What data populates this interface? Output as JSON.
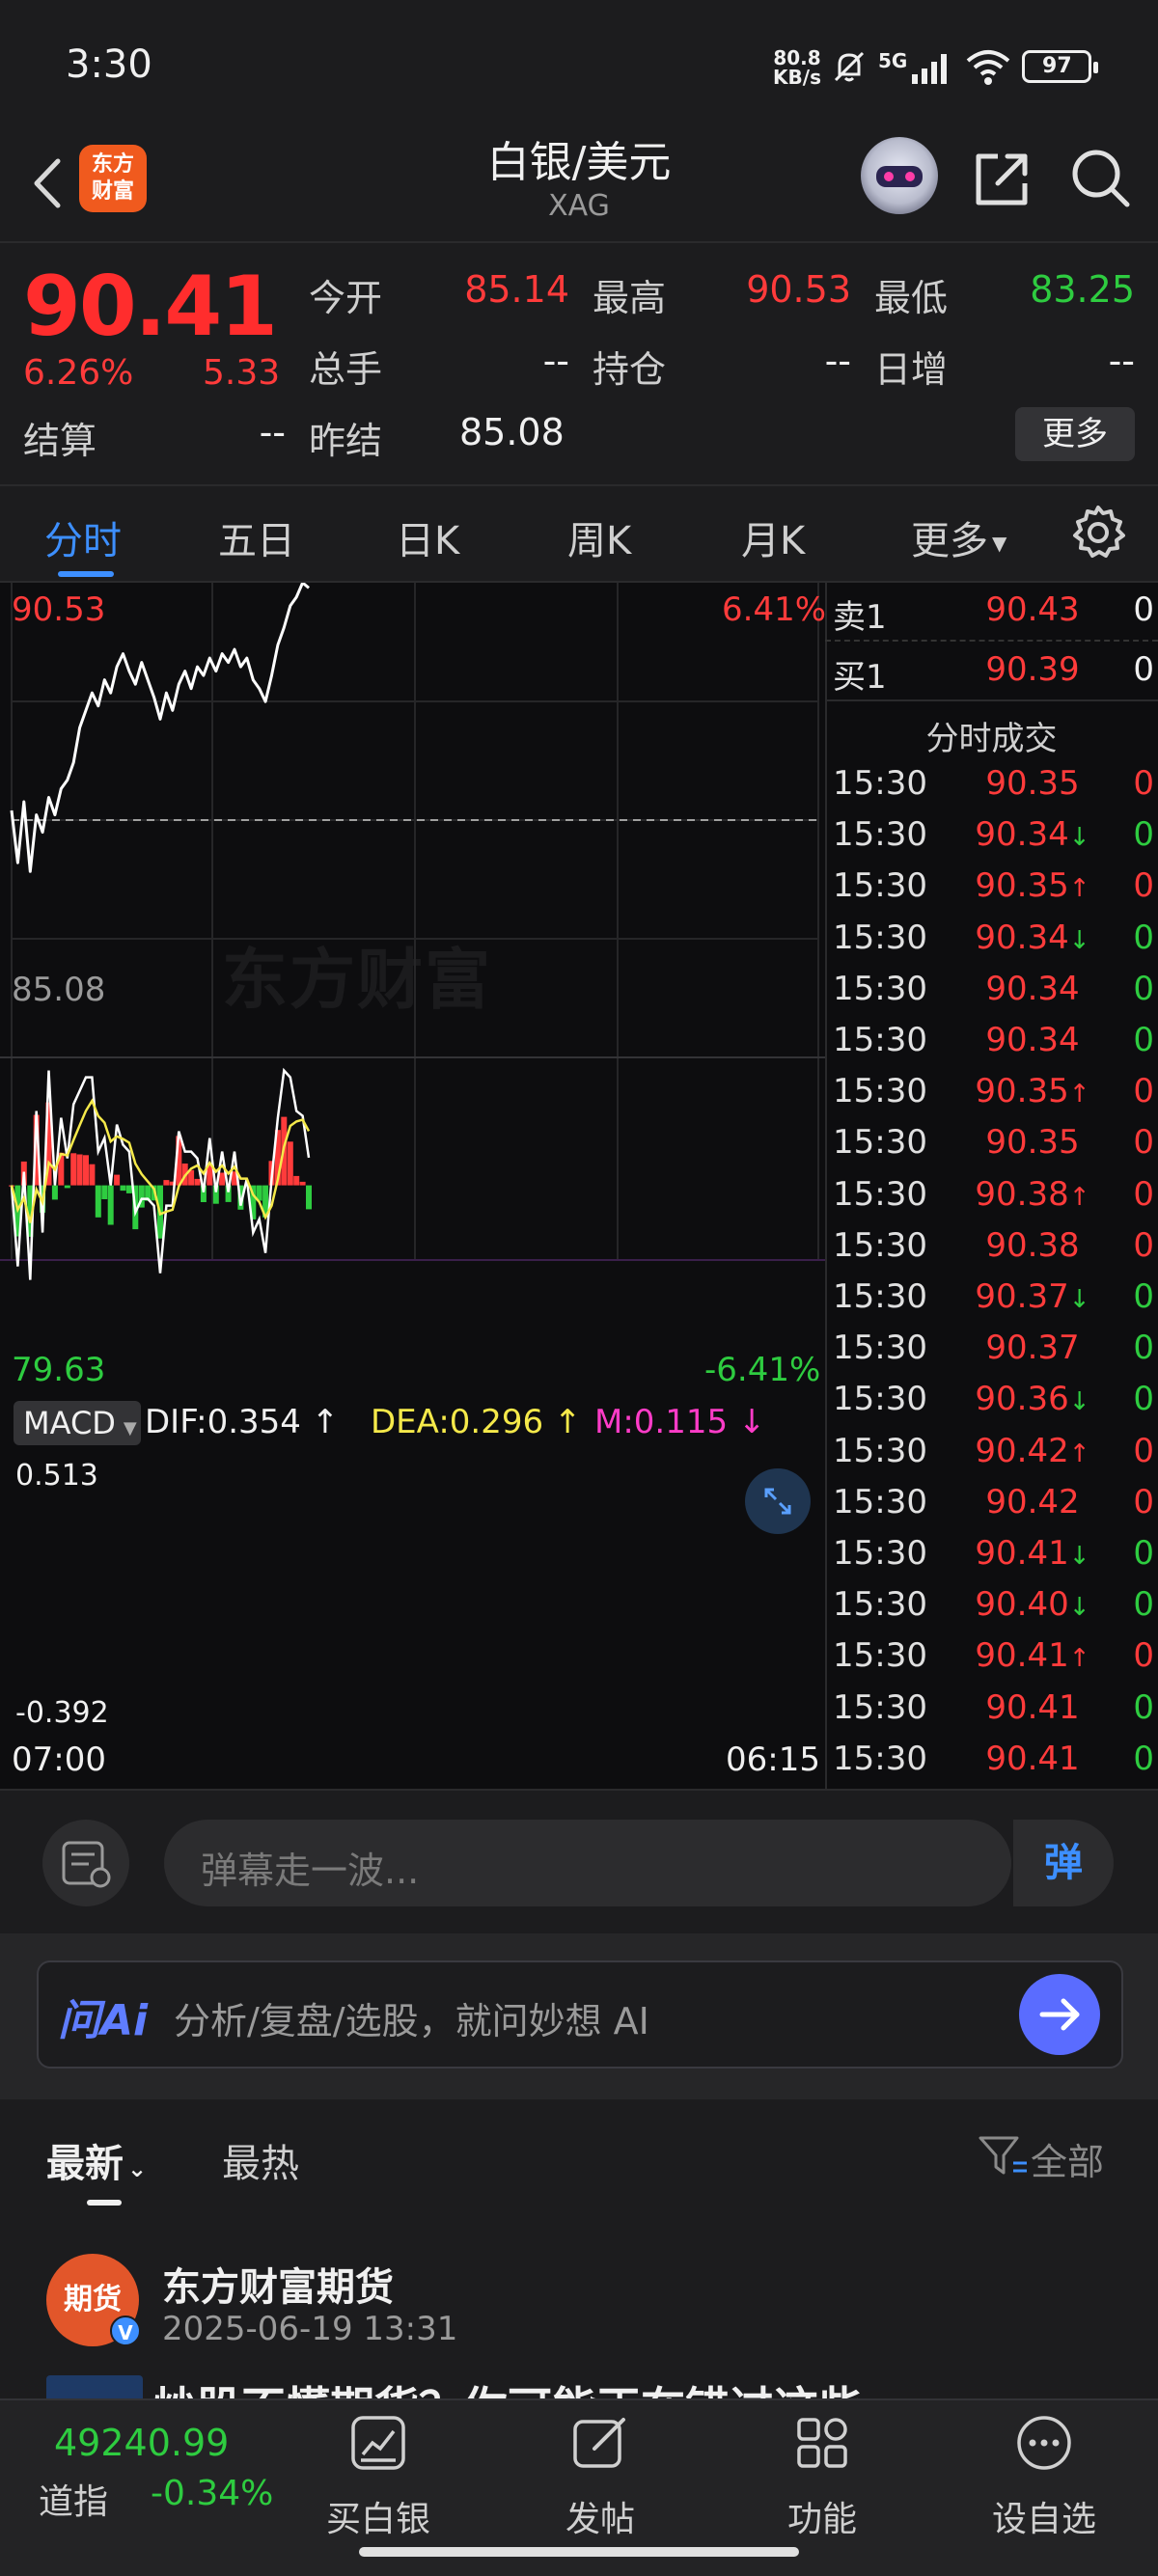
{
  "status_bar": {
    "time": "3:30",
    "net_speed_value": "80.8",
    "net_speed_unit": "KB/s",
    "network": "5G",
    "battery": "97"
  },
  "header": {
    "brand_logo_text": "东方\n财富",
    "title": "白银/美元",
    "subtitle": "XAG"
  },
  "quote": {
    "last_price": "90.41",
    "change_pct": "6.26%",
    "change_value": "5.33",
    "fields": [
      {
        "label": "今开",
        "value": "85.14"
      },
      {
        "label": "最高",
        "value": "90.53"
      },
      {
        "label": "最低",
        "value": "83.25"
      },
      {
        "label": "总手",
        "value": "--"
      },
      {
        "label": "持仓",
        "value": "--"
      },
      {
        "label": "日增",
        "value": "--"
      },
      {
        "label": "结算",
        "value": "--"
      },
      {
        "label": "昨结",
        "value": "85.08"
      }
    ],
    "more_label": "更多"
  },
  "tabs": [
    "分时",
    "五日",
    "日K",
    "周K",
    "月K",
    "更多"
  ],
  "chart": {
    "price_high_label": "90.53",
    "price_low_label": "79.63",
    "pct_high_label": "6.41%",
    "pct_low_label": "-6.41%",
    "prev_settle_label": "85.08",
    "time_start": "07:00",
    "time_end": "06:15",
    "watermark": "东方财富",
    "macd_name": "MACD",
    "macd_dif": "DIF:0.354",
    "macd_dea": "DEA:0.296",
    "macd_m": "M:0.115",
    "macd_max_label": "0.513",
    "macd_min_label": "-0.392",
    "colors": {
      "up": "#ff3b3b",
      "down": "#2ecc40",
      "price_line": "#ffffff",
      "dea_line": "#f5e94a",
      "macd_m": "#ff3cc8"
    }
  },
  "chart_data": {
    "type": "line",
    "title": "",
    "ylim": [
      79.63,
      90.53
    ],
    "prev_settle": 85.08,
    "series": [
      {
        "values": [
          85.3,
          84.1,
          85.5,
          83.9,
          85.2,
          84.8,
          85.6,
          85.2,
          85.8,
          86.0,
          86.4,
          87.2,
          87.6,
          88.0,
          87.7,
          88.3,
          88.0,
          88.6,
          88.9,
          88.5,
          88.2,
          88.7,
          88.3,
          87.9,
          87.4,
          88.0,
          87.6,
          88.2,
          88.5,
          88.1,
          88.6,
          88.4,
          88.8,
          88.5,
          88.9,
          88.7,
          89.0,
          88.6,
          88.8,
          88.3,
          88.1,
          87.8,
          88.4,
          89.1,
          89.5,
          90.0,
          90.2,
          90.53,
          90.41
        ]
      }
    ]
  },
  "order_book": [
    {
      "label": "卖1",
      "price": "90.43",
      "volume": "0"
    },
    {
      "label": "买1",
      "price": "90.39",
      "volume": "0"
    }
  ],
  "trades_title": "分时成交",
  "trades": [
    {
      "time": "15:30",
      "price": "90.35",
      "arrow": "",
      "volume": "0",
      "vol_color": "up"
    },
    {
      "time": "15:30",
      "price": "90.34",
      "arrow": "↓",
      "volume": "0",
      "vol_color": "down"
    },
    {
      "time": "15:30",
      "price": "90.35",
      "arrow": "↑",
      "volume": "0",
      "vol_color": "up"
    },
    {
      "time": "15:30",
      "price": "90.34",
      "arrow": "↓",
      "volume": "0",
      "vol_color": "down"
    },
    {
      "time": "15:30",
      "price": "90.34",
      "arrow": "",
      "volume": "0",
      "vol_color": "down"
    },
    {
      "time": "15:30",
      "price": "90.34",
      "arrow": "",
      "volume": "0",
      "vol_color": "down"
    },
    {
      "time": "15:30",
      "price": "90.35",
      "arrow": "↑",
      "volume": "0",
      "vol_color": "up"
    },
    {
      "time": "15:30",
      "price": "90.35",
      "arrow": "",
      "volume": "0",
      "vol_color": "up"
    },
    {
      "time": "15:30",
      "price": "90.38",
      "arrow": "↑",
      "volume": "0",
      "vol_color": "up"
    },
    {
      "time": "15:30",
      "price": "90.38",
      "arrow": "",
      "volume": "0",
      "vol_color": "up"
    },
    {
      "time": "15:30",
      "price": "90.37",
      "arrow": "↓",
      "volume": "0",
      "vol_color": "down"
    },
    {
      "time": "15:30",
      "price": "90.37",
      "arrow": "",
      "volume": "0",
      "vol_color": "down"
    },
    {
      "time": "15:30",
      "price": "90.36",
      "arrow": "↓",
      "volume": "0",
      "vol_color": "down"
    },
    {
      "time": "15:30",
      "price": "90.42",
      "arrow": "↑",
      "volume": "0",
      "vol_color": "up"
    },
    {
      "time": "15:30",
      "price": "90.42",
      "arrow": "",
      "volume": "0",
      "vol_color": "up"
    },
    {
      "time": "15:30",
      "price": "90.41",
      "arrow": "↓",
      "volume": "0",
      "vol_color": "down"
    },
    {
      "time": "15:30",
      "price": "90.40",
      "arrow": "↓",
      "volume": "0",
      "vol_color": "down"
    },
    {
      "time": "15:30",
      "price": "90.41",
      "arrow": "↑",
      "volume": "0",
      "vol_color": "up"
    },
    {
      "time": "15:30",
      "price": "90.41",
      "arrow": "",
      "volume": "0",
      "vol_color": "down"
    },
    {
      "time": "15:30",
      "price": "90.41",
      "arrow": "",
      "volume": "0",
      "vol_color": "down"
    }
  ],
  "danmu": {
    "placeholder": "弹幕走一波...",
    "toggle_label": "弹"
  },
  "ai": {
    "logo": "问Ai",
    "placeholder": "分析/复盘/选股，就问妙想 AI"
  },
  "feed": {
    "tab_latest": "最新",
    "tab_hot": "最热",
    "filter_label": "全部",
    "post": {
      "avatar_text": "期货",
      "author": "东方财富期货",
      "time": "2025-06-19 13:31",
      "title": "炒股不懂期货？你可能正在错过这些"
    }
  },
  "bottom_nav": {
    "index_value": "49240.99",
    "index_name": "道指",
    "index_change": "-0.34%",
    "items": [
      "买白银",
      "发帖",
      "功能",
      "设自选"
    ]
  }
}
